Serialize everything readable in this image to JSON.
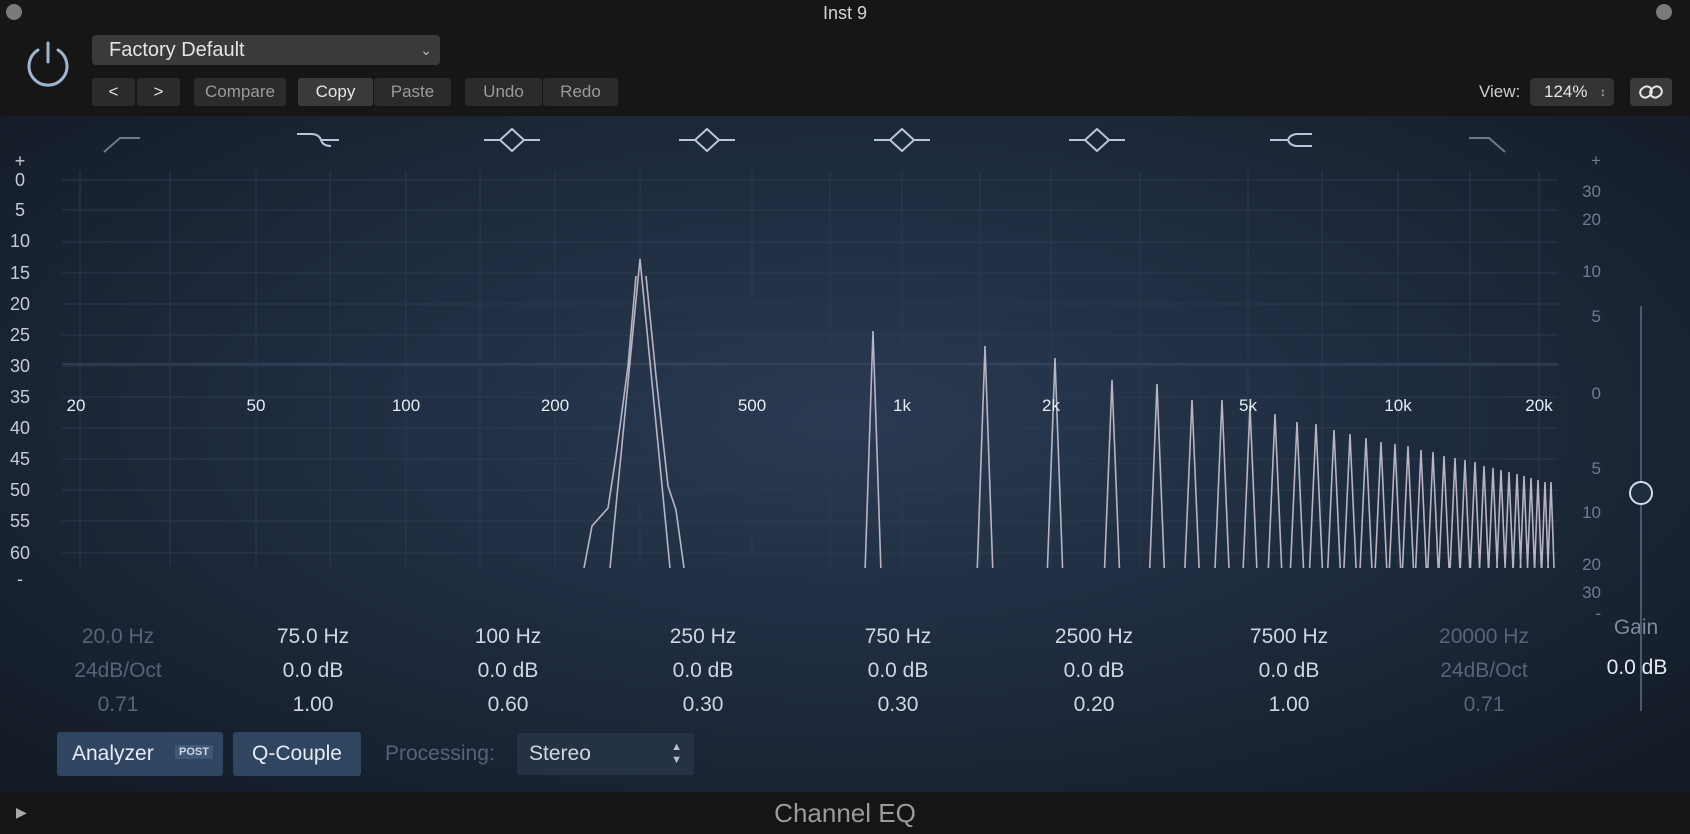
{
  "window": {
    "title": "Inst 9"
  },
  "header": {
    "preset": "Factory Default",
    "nav_prev": "<",
    "nav_next": ">",
    "compare": "Compare",
    "copy": "Copy",
    "paste": "Paste",
    "undo": "Undo",
    "redo": "Redo",
    "view_label": "View:",
    "view_zoom": "124%"
  },
  "graph": {
    "left_scale": [
      "+",
      "0",
      "5",
      "10",
      "15",
      "20",
      "25",
      "30",
      "35",
      "40",
      "45",
      "50",
      "55",
      "60",
      "-"
    ],
    "right_scale": [
      "+",
      "30",
      "20",
      "10",
      "5",
      "0",
      "5",
      "10",
      "20",
      "30",
      "-"
    ],
    "freq_labels": [
      "20",
      "50",
      "100",
      "200",
      "500",
      "1k",
      "2k",
      "5k",
      "10k",
      "20k"
    ]
  },
  "bands": [
    {
      "freq": "20.0 Hz",
      "gain": "24dB/Oct",
      "q": "0.71",
      "enabled": false,
      "shape": "low-cut-icon"
    },
    {
      "freq": "75.0 Hz",
      "gain": "0.0 dB",
      "q": "1.00",
      "enabled": true,
      "shape": "low-shelf-icon"
    },
    {
      "freq": "100 Hz",
      "gain": "0.0 dB",
      "q": "0.60",
      "enabled": true,
      "shape": "bell-icon"
    },
    {
      "freq": "250 Hz",
      "gain": "0.0 dB",
      "q": "0.30",
      "enabled": true,
      "shape": "bell-icon"
    },
    {
      "freq": "750 Hz",
      "gain": "0.0 dB",
      "q": "0.30",
      "enabled": true,
      "shape": "bell-icon"
    },
    {
      "freq": "2500 Hz",
      "gain": "0.0 dB",
      "q": "0.20",
      "enabled": true,
      "shape": "bell-icon"
    },
    {
      "freq": "7500 Hz",
      "gain": "0.0 dB",
      "q": "1.00",
      "enabled": true,
      "shape": "high-shelf-icon"
    },
    {
      "freq": "20000 Hz",
      "gain": "24dB/Oct",
      "q": "0.71",
      "enabled": false,
      "shape": "high-cut-icon"
    }
  ],
  "gain": {
    "label": "Gain",
    "value": "0.0 dB"
  },
  "controls": {
    "analyzer": "Analyzer",
    "analyzer_badge": "POST",
    "qcouple": "Q-Couple",
    "processing_label": "Processing:",
    "processing_value": "Stereo"
  },
  "footer": {
    "title": "Channel EQ"
  },
  "colors": {
    "accent": "#2f4560",
    "spectrum": "#c9c3cf",
    "grid": "#2c3a4e"
  }
}
